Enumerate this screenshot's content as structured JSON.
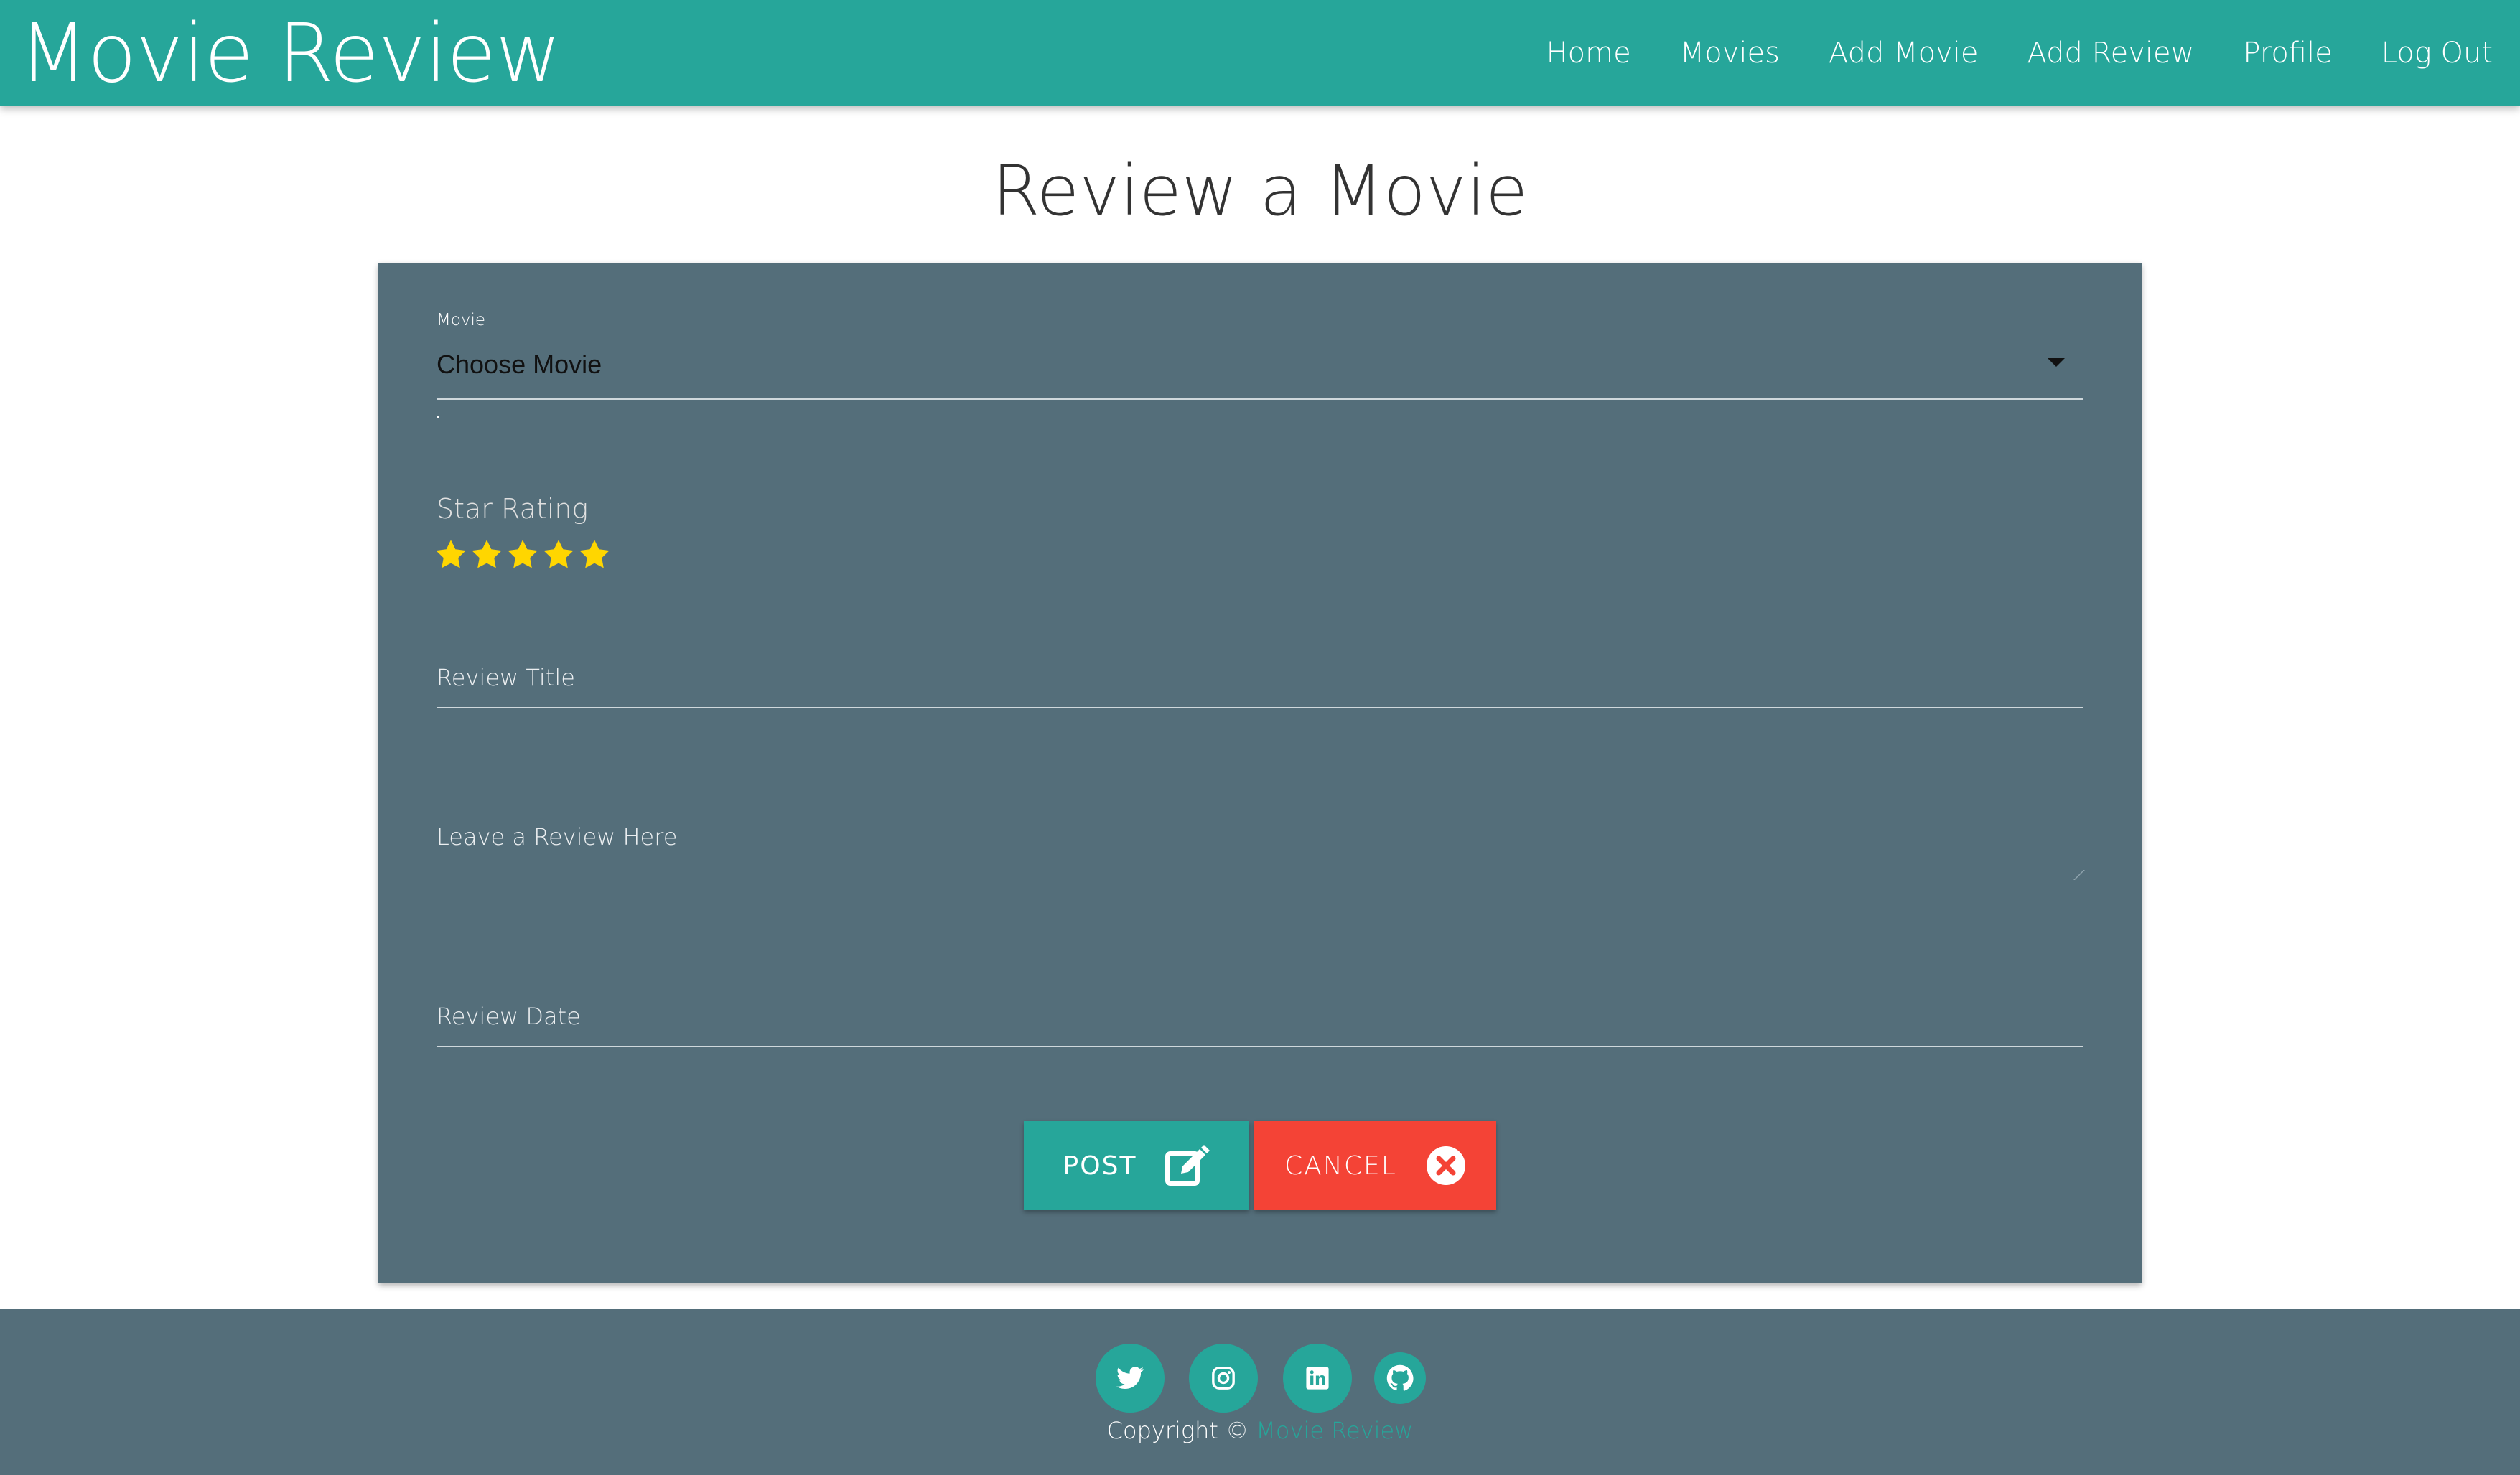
{
  "brand": "Movie Review",
  "nav": [
    "Home",
    "Movies",
    "Add Movie",
    "Add Review",
    "Profile",
    "Log Out"
  ],
  "page_title": "Review a Movie",
  "form": {
    "movie_label": "Movie",
    "movie_selected": "Choose Movie",
    "rating_label": "Star Rating",
    "rating": {
      "value": 5,
      "max": 5,
      "color": "#ffd600"
    },
    "review_title_placeholder": "Review Title",
    "review_body_placeholder": "Leave a Review Here",
    "review_date_placeholder": "Review Date",
    "post_label": "POST",
    "cancel_label": "CANCEL"
  },
  "footer": {
    "social": [
      "twitter-icon",
      "instagram-icon",
      "linkedin-icon",
      "github-icon"
    ],
    "copyright_prefix": "Copyright ©",
    "copyright_link": "Movie Review"
  },
  "colors": {
    "primary": "#26a69a",
    "card": "#546e7a",
    "danger": "#f44336"
  }
}
